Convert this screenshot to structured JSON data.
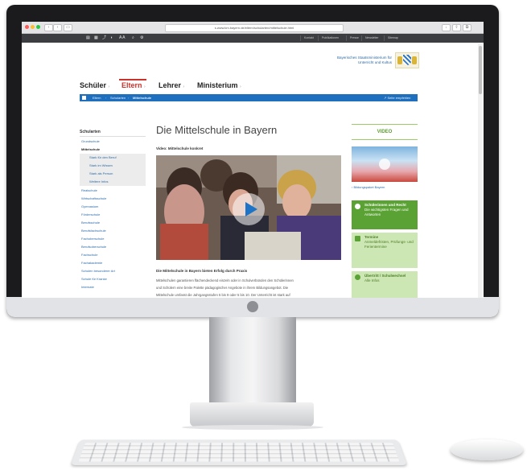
{
  "browser": {
    "url": "s.www.km.bayern.de/eltern/schularten/mittelschule.html"
  },
  "site": {
    "toolbar_icons": [
      "print-icon",
      "grid-icon",
      "share-icon",
      "audio-icon",
      "text-size-icon",
      "search-icon",
      "settings-icon"
    ],
    "font_size_label": "A A",
    "top_links": [
      "Kontakt",
      "Publikationen",
      "Presse",
      "Newsletter",
      "Sitemap"
    ],
    "ministry_name": "Bayerisches Staatsministerium für Unterricht und Kultus",
    "main_nav": [
      {
        "label": "Schüler",
        "active": false
      },
      {
        "label": "Eltern",
        "active": true
      },
      {
        "label": "Lehrer",
        "active": false
      },
      {
        "label": "Ministerium",
        "active": false
      }
    ],
    "breadcrumb": [
      "Eltern",
      "Schularten",
      "Mittelschule"
    ],
    "breadcrumb_right": "Seite empfehlen"
  },
  "sidebar": {
    "heading": "Schularten",
    "items": [
      {
        "label": "Grundschule",
        "type": "normal"
      },
      {
        "label": "Mittelschule",
        "type": "active"
      },
      {
        "label": "Stark für den Beruf",
        "type": "sub"
      },
      {
        "label": "Stark im Wissen",
        "type": "sub"
      },
      {
        "label": "Stark als Person",
        "type": "sub"
      },
      {
        "label": "Weitere Infos",
        "type": "sub"
      },
      {
        "label": "Realschule",
        "type": "normal"
      },
      {
        "label": "Wirtschaftsschule",
        "type": "normal"
      },
      {
        "label": "Gymnasium",
        "type": "normal"
      },
      {
        "label": "Förderschule",
        "type": "normal"
      },
      {
        "label": "Berufsschule",
        "type": "normal"
      },
      {
        "label": "Berufsfachschule",
        "type": "normal"
      },
      {
        "label": "Fachoberschule",
        "type": "normal"
      },
      {
        "label": "Berufsoberschule",
        "type": "normal"
      },
      {
        "label": "Fachschule",
        "type": "normal"
      },
      {
        "label": "Fachakademie",
        "type": "normal"
      },
      {
        "label": "Schulen besonderer Art",
        "type": "normal"
      },
      {
        "label": "Schule für Kranke",
        "type": "normal"
      },
      {
        "label": "Internate",
        "type": "normal"
      }
    ]
  },
  "main": {
    "title": "Die Mittelschule in Bayern",
    "video_label": "Video: Mittelschule konkret",
    "paragraph_heading": "Die Mittelschule in Bayern bieten Erfolg durch Praxis",
    "paragraph_lines": [
      "Mittelschulen garantieren flächendeckend einzeln oder in Schulverbünden den Schülerinnen",
      "und Schülern eine breite Palette pädagogischer Angebote in ihrem Bildungsangebot. Die",
      "Mittelschule umfasst die Jahrgangsstufen 5 bis 9 oder 5 bis 10. Der Unterricht ist stark auf"
    ]
  },
  "right_column": {
    "video_heading": "VIDEO",
    "video_caption": "› Bildungspaket Bayern",
    "boxes": [
      {
        "title": "Schülerinnen und Recht",
        "subtitle": "Die wichtigsten Fragen und Antworten",
        "bg": "#5aa233",
        "fg": "#ffffff"
      },
      {
        "title": "Termine",
        "subtitle": "Anmeldefristen, Prüfungs- und Ferientermine",
        "bg": "#cde7b4",
        "fg": "#4a7d24"
      },
      {
        "title": "Übertritt / Schulwechsel",
        "subtitle": "Alle Infos",
        "bg": "#cde7b4",
        "fg": "#4a7d24"
      }
    ]
  },
  "colors": {
    "accent_blue": "#1e6fbd",
    "accent_red": "#c9332c",
    "accent_green": "#5aa233"
  }
}
